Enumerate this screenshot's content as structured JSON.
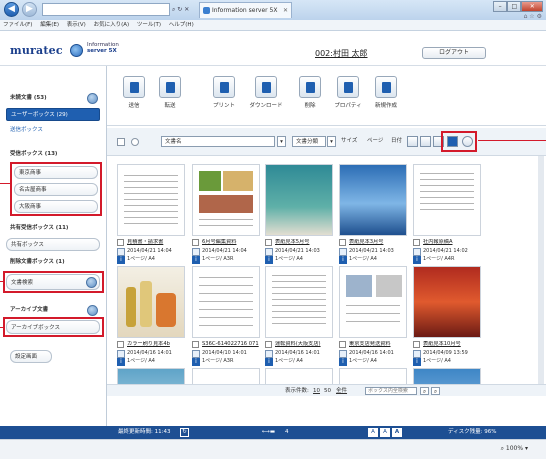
{
  "browser": {
    "address": "",
    "tab_title": "Information server 5X",
    "menu": [
      "ファイル(F)",
      "編集(E)",
      "表示(V)",
      "お気に入り(A)",
      "ツール(T)",
      "ヘルプ(H)"
    ]
  },
  "header": {
    "brand": "muratec",
    "product_line1": "Information",
    "product_line2": "server 5X",
    "user": "002:村田 太郎",
    "logout_label": "ログアウト"
  },
  "sidebar": {
    "unread": "未読文書 (53)",
    "user_box": "ユーザーボックス (29)",
    "sent_box": "送信ボックス",
    "received_box": "受信ボックス (13)",
    "received_items": [
      "東京商事",
      "名古屋商事",
      "大阪商事"
    ],
    "shared_received": "共有受信ボックス (11)",
    "shared_box": "共有ボックス",
    "deleted": "削除文書ボックス (1)",
    "doc_search": "文書検索",
    "archive_doc": "アーカイブ文書",
    "archive_box": "アーカイブボックス",
    "settings": "設定画面"
  },
  "toolbar": [
    "送信",
    "転送",
    "プリント",
    "ダウンロード",
    "削除",
    "プロパティ",
    "新規作成"
  ],
  "filter": {
    "doc_name": "文書名",
    "doc_class": "文書分類",
    "labels": [
      "サイズ",
      "ページ",
      "日付"
    ]
  },
  "docs": [
    {
      "title": "見積書・請求書",
      "date": "2014/04/21 14:04",
      "pages": "1ページ/ A4"
    },
    {
      "title": "6月号編集資料",
      "date": "2014/04/21 14:04",
      "pages": "1ページ/ A3R"
    },
    {
      "title": "表紙見本5月号",
      "date": "2014/04/21 14:03",
      "pages": "1ページ/ A4"
    },
    {
      "title": "表紙見本3月号",
      "date": "2014/04/21 14:03",
      "pages": "1ページ/ A4"
    },
    {
      "title": "社内報原稿A",
      "date": "2014/04/21 14:02",
      "pages": "1ページ/ A4R"
    },
    {
      "title": "カラー刷り見本4b",
      "date": "2014/04/16 14:01",
      "pages": "1ページ/ A4"
    },
    {
      "title": "S36C-614022716 071",
      "date": "2014/04/10 14:01",
      "pages": "1ページ/ A3R"
    },
    {
      "title": "運転資料(大阪支店)",
      "date": "2014/04/16 14:01",
      "pages": "1ページ/ A4"
    },
    {
      "title": "東京支店発送資料",
      "date": "2014/04/16 14:01",
      "pages": "1ページ/ A4"
    },
    {
      "title": "表紙見本10月号",
      "date": "2014/04/09 13:59",
      "pages": "1ページ/ A4"
    }
  ],
  "pager": {
    "count_label": "表示件数:",
    "count_10": "10",
    "count_50": "50",
    "count_all": "全件",
    "box_search": "ボックス内全検索"
  },
  "status": {
    "updated": "最終更新時間: 11:43",
    "arrow": "4",
    "font_sizes": [
      "A",
      "A",
      "A"
    ],
    "disk": "ディスク残量: 96%"
  },
  "zoom": "100%",
  "colors": {
    "accent": "#1f5fb0",
    "highlight": "#d31a2b"
  }
}
